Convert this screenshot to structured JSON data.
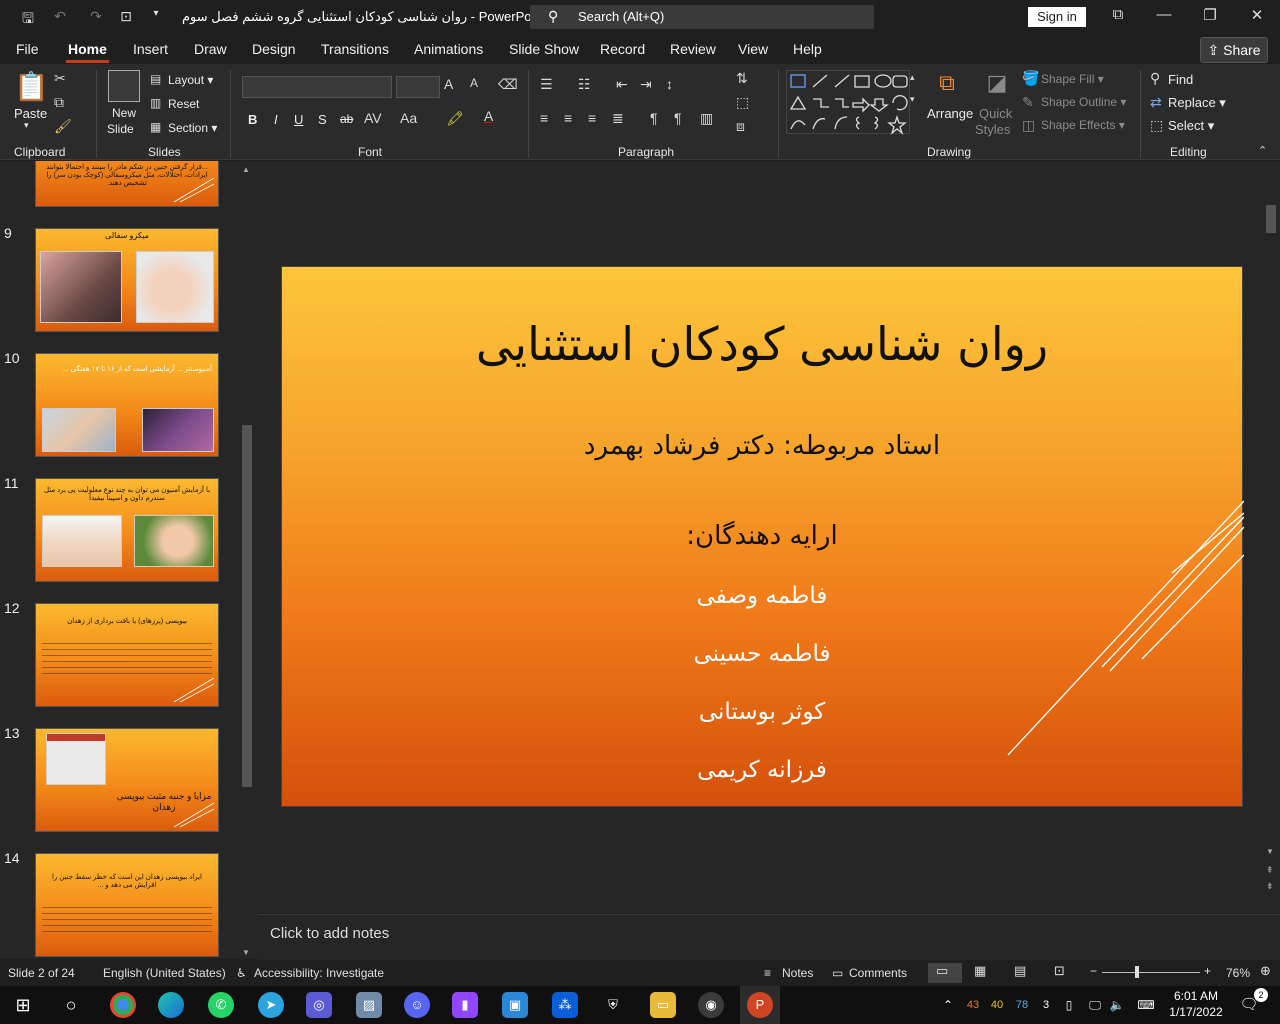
{
  "window": {
    "title": "روان شناسی کودکان استثنایی گروه ششم فصل سوم  -  PowerPoint",
    "search": "Search (Alt+Q)",
    "sign_in": "Sign in"
  },
  "menu": {
    "tabs": [
      "File",
      "Home",
      "Insert",
      "Draw",
      "Design",
      "Transitions",
      "Animations",
      "Slide Show",
      "Record",
      "Review",
      "View",
      "Help"
    ],
    "active": "Home",
    "share": "Share"
  },
  "ribbon": {
    "clipboard": {
      "label": "Clipboard",
      "paste": "Paste"
    },
    "slides": {
      "label": "Slides",
      "new_slide_1": "New",
      "new_slide_2": "Slide",
      "layout": "Layout",
      "reset": "Reset",
      "section": "Section"
    },
    "font": {
      "label": "Font",
      "bold": "B",
      "italic": "I",
      "underline": "U",
      "shadow": "S",
      "strike": "ab"
    },
    "paragraph": {
      "label": "Paragraph"
    },
    "drawing": {
      "label": "Drawing",
      "arrange": "Arrange",
      "quick_styles_1": "Quick",
      "quick_styles_2": "Styles",
      "shape_fill": "Shape Fill",
      "shape_outline": "Shape Outline",
      "shape_effects": "Shape Effects"
    },
    "editing": {
      "label": "Editing",
      "find": "Find",
      "replace": "Replace",
      "select": "Select"
    }
  },
  "thumbnails": [
    {
      "num": "",
      "text": "...قرار گرفتن جنین در شکم مادر را ببینند و احتمالا بتوانند ایرادات، اختلالات، مثل میکروسفالی (کوچک بودن سر) را تشخیص دهند."
    },
    {
      "num": "9",
      "text": "میکرو سفالی"
    },
    {
      "num": "10",
      "text": "آمنیوسنتز ... آزمایشی است که از ۱۶ تا ۱۷ هفتگی ..."
    },
    {
      "num": "11",
      "text": "با آزمایش آمنیون می توان به چند نوع معلولیت پی برد مثل سندرم داون و اسپینا بیفیدا"
    },
    {
      "num": "12",
      "text": "بیوپسی (پرزهای) یا بافت برداری از زهدان"
    },
    {
      "num": "13",
      "text": "مزایا و جنبه مثبت بیوپسی زهدان"
    },
    {
      "num": "14",
      "text": "ایراد بیوپسی زهدان این است که خطر سقط جنین را افزایش می دهد و ..."
    }
  ],
  "slide": {
    "title": "روان شناسی کودکان استثنایی",
    "instructor": "استاد مربوطه: دکتر فرشاد بهمرد",
    "presenters_label": "ارایه دهندگان:",
    "presenters": [
      "فاطمه وصفی",
      "فاطمه حسینی",
      "کوثر بوستانی",
      "فرزانه کریمی"
    ]
  },
  "notes_placeholder": "Click to add notes",
  "status": {
    "slide": "Slide 2 of 24",
    "language": "English (United States)",
    "accessibility": "Accessibility: Investigate",
    "notes": "Notes",
    "comments": "Comments",
    "zoom": "76%"
  },
  "taskbar": {
    "time": "6:01 AM",
    "date": "1/17/2022",
    "tray_nums": [
      "43",
      "40",
      "78",
      "3"
    ],
    "notifications": "2"
  }
}
